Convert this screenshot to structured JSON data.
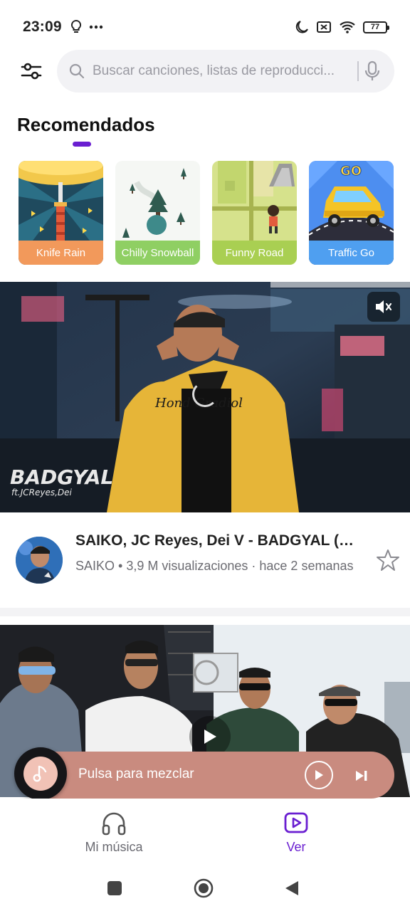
{
  "status_bar": {
    "time": "23:09",
    "battery": "77",
    "icons": [
      "lightbulb-icon",
      "more-dots-icon",
      "moon-icon",
      "sim-off-icon",
      "wifi-icon",
      "battery-icon"
    ]
  },
  "search": {
    "placeholder": "Buscar canciones, listas de reproducci..."
  },
  "recommended": {
    "title": "Recomendados",
    "games": [
      {
        "label": "Knife Rain",
        "color": "#f2995b"
      },
      {
        "label": "Chilly Snowball",
        "color": "#8fcf63"
      },
      {
        "label": "Funny Road",
        "color": "#a9cf52"
      },
      {
        "label": "Traffic Go",
        "color": "#4f9ff0"
      }
    ]
  },
  "video1": {
    "overlay_text_1": "BADGYAL",
    "overlay_text_2": "ft.JCReyes,Dei",
    "title": "SAIKO, JC Reyes, Dei V - BADGYAL (V...",
    "meta": "SAIKO  •  3,9 M visualizaciones  · hace 2 semanas"
  },
  "mini_player": {
    "text": "Pulsa para mezclar",
    "bg_color": "#c98b7f"
  },
  "bottom_nav": {
    "my_music": "Mi música",
    "watch": "Ver",
    "active_color": "#6a1fd1"
  }
}
